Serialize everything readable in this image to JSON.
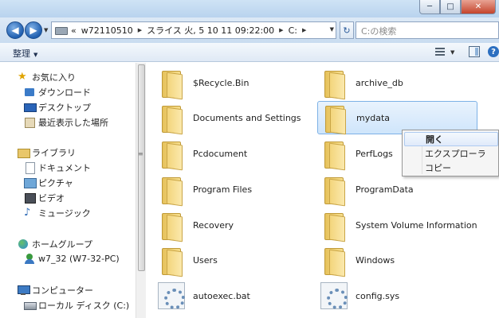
{
  "window": {
    "minimize_glyph": "─",
    "maximize_glyph": "□",
    "close_glyph": "✕"
  },
  "address_bar": {
    "back_glyph": "◀",
    "forward_glyph": "▶",
    "overflow": "«",
    "crumbs": [
      "w72110510",
      "スライス 火, 5 10 11 09:22:00",
      "C:"
    ],
    "refresh_glyph": "↻"
  },
  "search": {
    "placeholder": "C:の検索"
  },
  "toolbar": {
    "organize_label": "整理"
  },
  "nav_pane": {
    "favorites": {
      "label": "お気に入り",
      "items": [
        "ダウンロード",
        "デスクトップ",
        "最近表示した場所"
      ]
    },
    "libraries": {
      "label": "ライブラリ",
      "items": [
        "ドキュメント",
        "ピクチャ",
        "ビデオ",
        "ミュージック"
      ]
    },
    "homegroup": {
      "label": "ホームグループ",
      "items": [
        "w7_32 (W7-32-PC)"
      ]
    },
    "computer": {
      "label": "コンピューター",
      "items": [
        "ローカル ディスク (C:)"
      ]
    }
  },
  "files": [
    {
      "name": "$Recycle.Bin",
      "type": "folder"
    },
    {
      "name": "archive_db",
      "type": "folder"
    },
    {
      "name": "Documents and Settings",
      "type": "folder"
    },
    {
      "name": "mydata",
      "type": "folder",
      "selected": true
    },
    {
      "name": "Pcdocument",
      "type": "folder"
    },
    {
      "name": "PerfLogs",
      "type": "folder"
    },
    {
      "name": "Program Files",
      "type": "folder"
    },
    {
      "name": "ProgramData",
      "type": "folder"
    },
    {
      "name": "Recovery",
      "type": "folder"
    },
    {
      "name": "System Volume Information",
      "type": "folder"
    },
    {
      "name": "Users",
      "type": "folder"
    },
    {
      "name": "Windows",
      "type": "folder"
    },
    {
      "name": "autoexec.bat",
      "type": "system-file"
    },
    {
      "name": "config.sys",
      "type": "system-file"
    }
  ],
  "context_menu": {
    "items": [
      "開く",
      "エクスプローラ",
      "コピー"
    ],
    "default_item": "開く"
  },
  "colors": {
    "titlebar": "#c9dcf0",
    "selection": "#cfe5fb",
    "selection_border": "#7db1e6",
    "folder": "#f3d57c"
  }
}
